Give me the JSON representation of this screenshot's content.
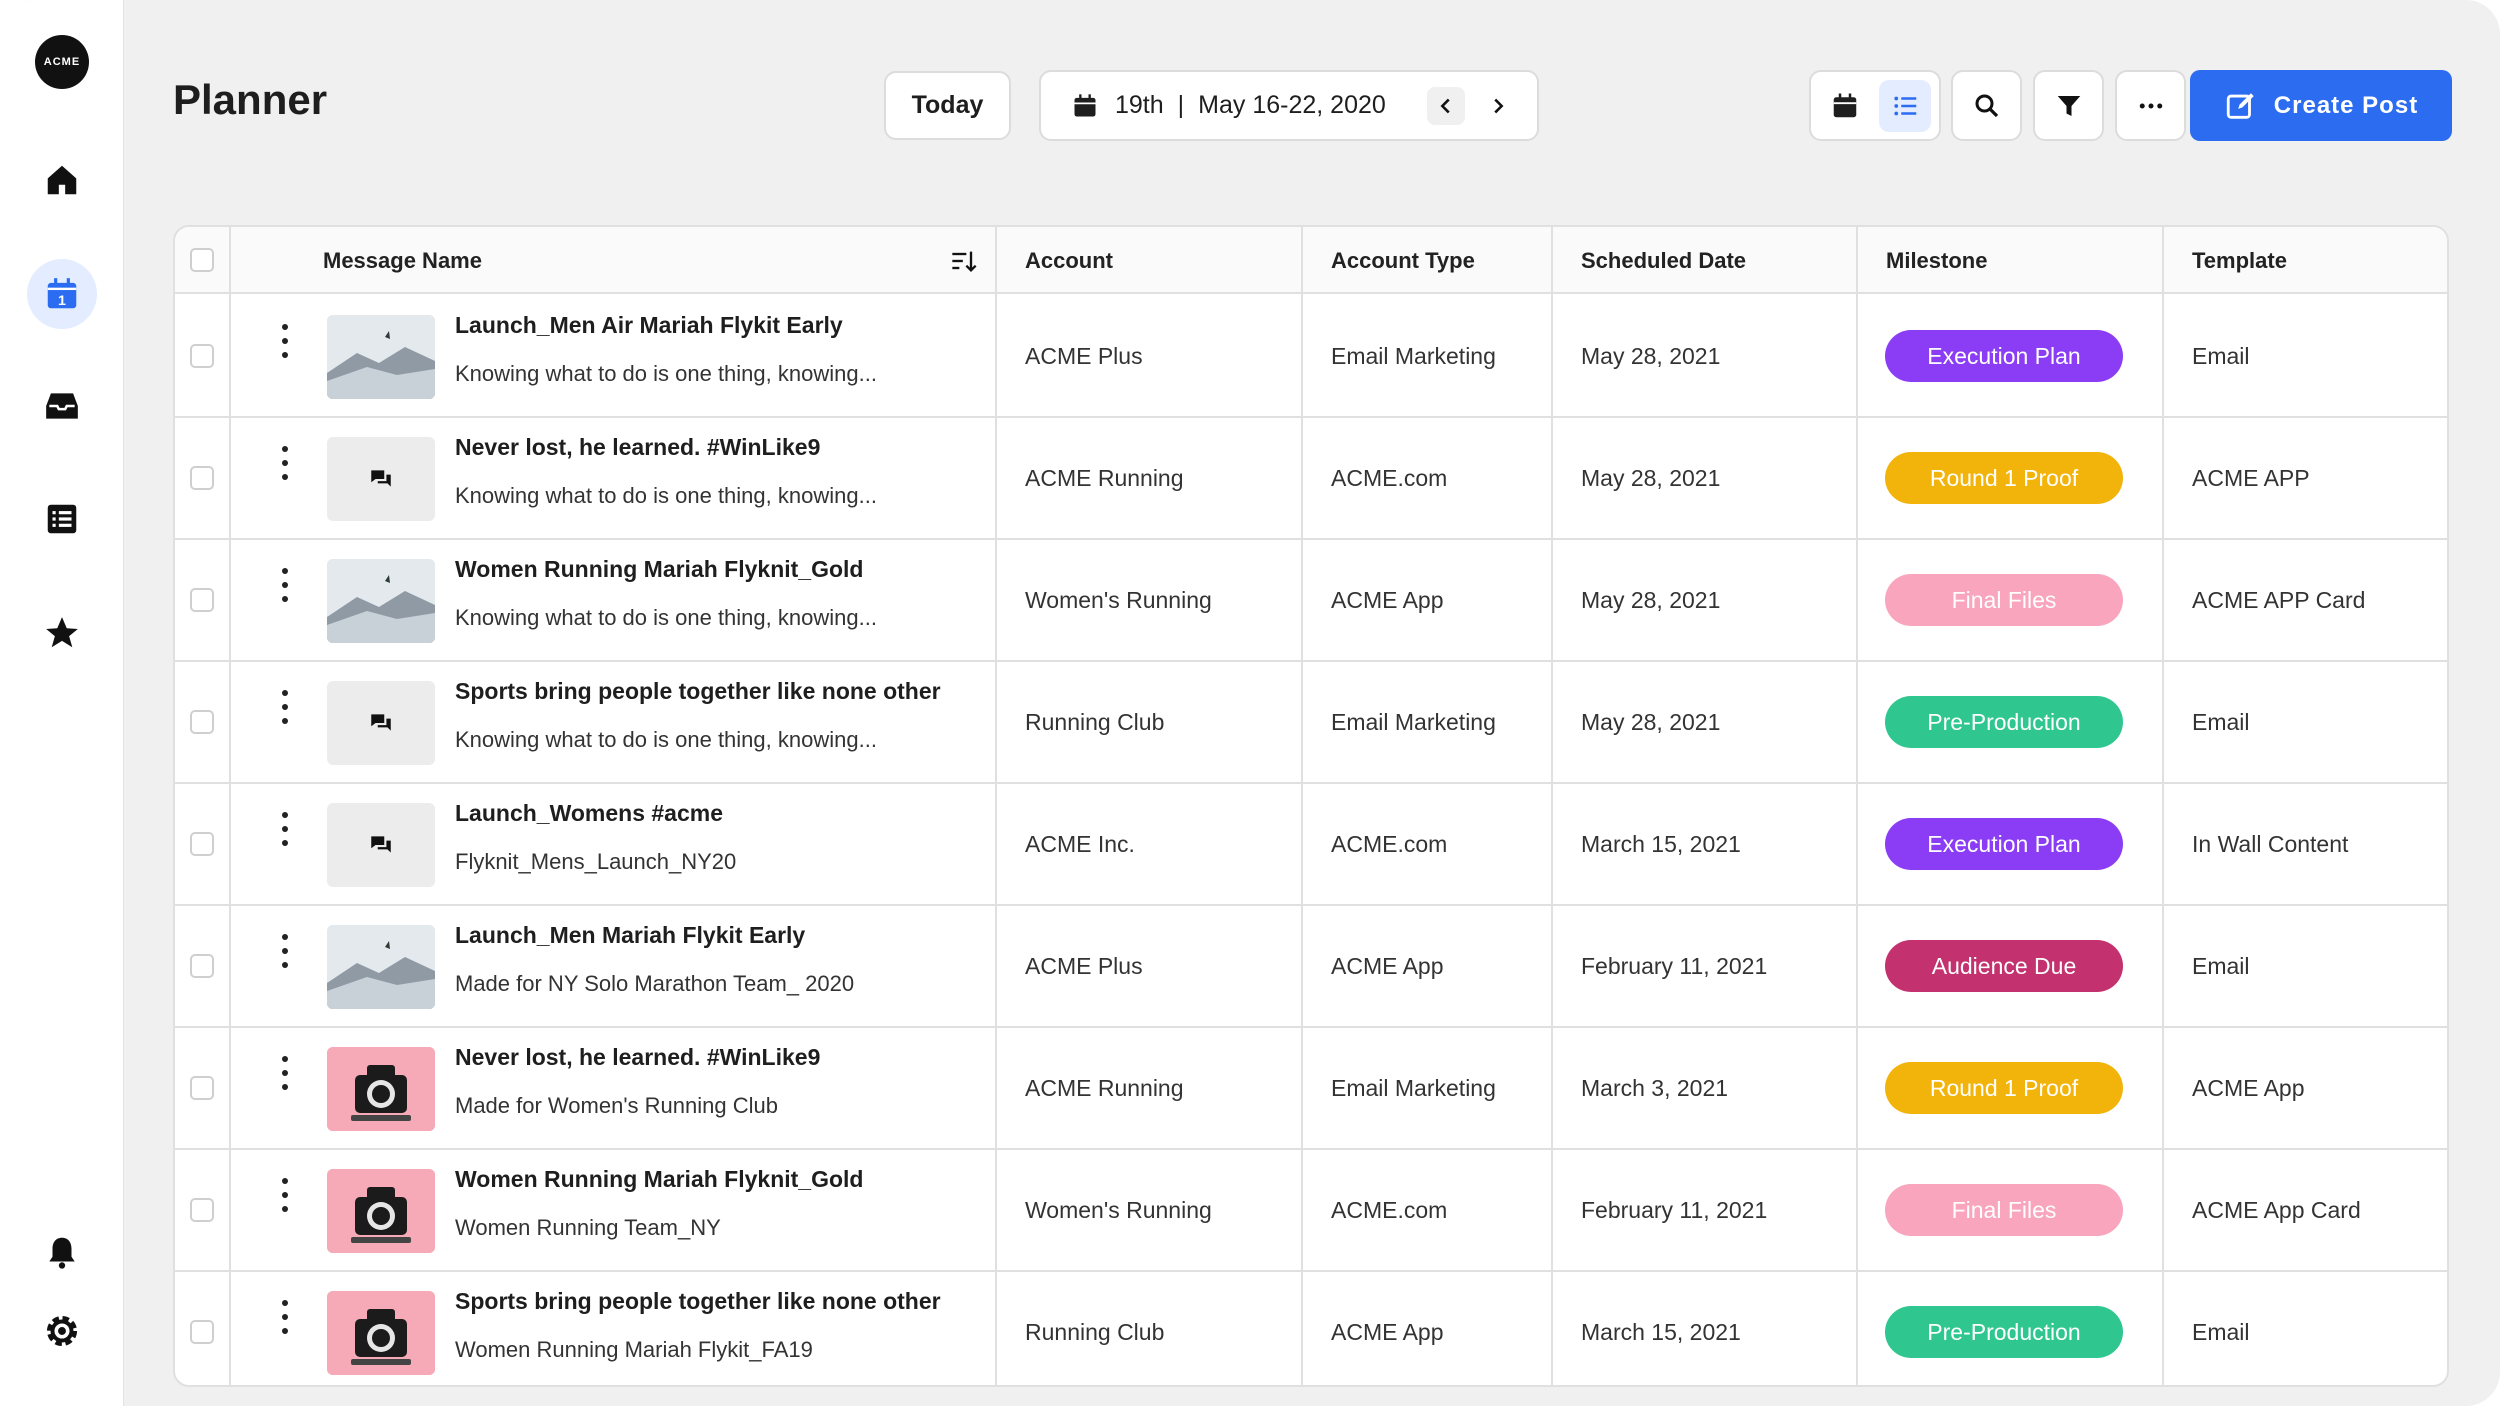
{
  "app": {
    "logo_text": "ACME"
  },
  "sidebar": {
    "items": [
      {
        "icon": "home-icon"
      },
      {
        "icon": "calendar-icon",
        "label": "1",
        "active": true
      },
      {
        "icon": "inbox-icon"
      },
      {
        "icon": "list-icon"
      },
      {
        "icon": "star-icon"
      }
    ],
    "bottom": [
      {
        "icon": "bell-icon"
      },
      {
        "icon": "gear-icon"
      }
    ]
  },
  "header": {
    "title": "Planner",
    "today_label": "Today",
    "date_day": "19th",
    "date_separator": "|",
    "date_range": "May 16-22, 2020",
    "create_label": "Create Post"
  },
  "table": {
    "columns": [
      "Message Name",
      "Account",
      "Account Type",
      "Scheduled Date",
      "Milestone",
      "Template"
    ],
    "rows": [
      {
        "thumb": "snow",
        "title": "Launch_Men Air Mariah Flykit Early",
        "sub": "Knowing what to do is one thing, knowing...",
        "account": "ACME Plus",
        "type": "Email Marketing",
        "date": "May 28, 2021",
        "milestone": "Execution Plan",
        "milestone_color": "#8b3df6",
        "template": "Email"
      },
      {
        "thumb": "chat",
        "title": "Never lost, he learned. #WinLike9",
        "sub": "Knowing what to do is one thing, knowing...",
        "account": "ACME Running",
        "type": "ACME.com",
        "date": "May 28, 2021",
        "milestone": "Round 1 Proof",
        "milestone_color": "#f2b40a",
        "template": "ACME APP"
      },
      {
        "thumb": "snow",
        "title": "Women Running Mariah Flyknit_Gold",
        "sub": "Knowing what to do is one thing, knowing...",
        "account": "Women's Running",
        "type": "ACME App",
        "date": "May 28, 2021",
        "milestone": "Final Files",
        "milestone_color": "#f8a5bd",
        "template": "ACME APP Card"
      },
      {
        "thumb": "chat",
        "title": "Sports bring people together like none other",
        "sub": "Knowing what to do is one thing, knowing...",
        "account": "Running Club",
        "type": "Email Marketing",
        "date": "May 28, 2021",
        "milestone": "Pre-Production",
        "milestone_color": "#2fc78f",
        "template": "Email"
      },
      {
        "thumb": "chat",
        "title": "Launch_Womens #acme",
        "sub": "Flyknit_Mens_Launch_NY20",
        "account": "ACME Inc.",
        "type": "ACME.com",
        "date": "March 15, 2021",
        "milestone": "Execution Plan",
        "milestone_color": "#8b3df6",
        "template": "In Wall Content"
      },
      {
        "thumb": "snow",
        "title": "Launch_Men Mariah Flykit Early",
        "sub": "Made for NY Solo Marathon Team_ 2020",
        "account": "ACME Plus",
        "type": "ACME App",
        "date": "February 11, 2021",
        "milestone": "Audience Due",
        "milestone_color": "#c3326f",
        "template": "Email"
      },
      {
        "thumb": "cam",
        "title": "Never lost, he learned. #WinLike9",
        "sub": "Made for Women's Running Club",
        "account": "ACME Running",
        "type": "Email Marketing",
        "date": "March 3, 2021",
        "milestone": "Round 1 Proof",
        "milestone_color": "#f2b40a",
        "template": "ACME App"
      },
      {
        "thumb": "cam",
        "title": "Women Running Mariah Flyknit_Gold",
        "sub": "Women Running Team_NY",
        "account": "Women's Running",
        "type": "ACME.com",
        "date": "February 11, 2021",
        "milestone": "Final Files",
        "milestone_color": "#f8a5bd",
        "template": "ACME App Card"
      },
      {
        "thumb": "cam",
        "title": "Sports bring people together like none other",
        "sub": "Women Running Mariah Flykit_FA19",
        "account": "Running Club",
        "type": "ACME App",
        "date": "March 15, 2021",
        "milestone": "Pre-Production",
        "milestone_color": "#2fc78f",
        "template": "Email"
      }
    ]
  }
}
